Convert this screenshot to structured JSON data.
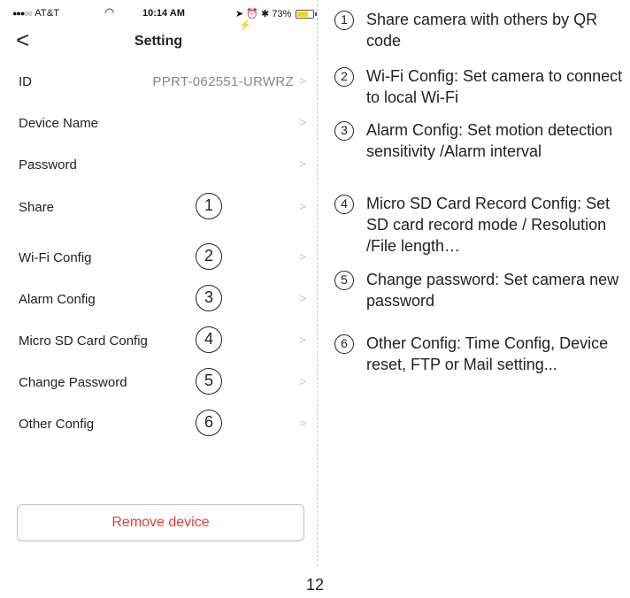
{
  "status_bar": {
    "signal": "●●●○○",
    "carrier": "AT&T",
    "time": "10:14 AM",
    "battery": "73%",
    "battery_level": 0.73
  },
  "nav": {
    "back_label": "<",
    "title": "Setting"
  },
  "rows": [
    {
      "label": "ID",
      "value": "PPRT-062551-URWRZ"
    },
    {
      "label": "Device Name"
    },
    {
      "label": "Password"
    },
    {
      "label": "Share",
      "num": "1"
    },
    {
      "label": "Wi-Fi Config",
      "num": "2"
    },
    {
      "label": "Alarm Config",
      "num": "3"
    },
    {
      "label": "Micro SD Card Config",
      "num": "4"
    },
    {
      "label": "Change Password",
      "num": "5"
    },
    {
      "label": "Other Config",
      "num": "6"
    }
  ],
  "chevron": ">",
  "remove_button": "Remove device",
  "legend": [
    {
      "num": "1",
      "text": "Share camera with others by QR code"
    },
    {
      "num": "2",
      "text": "Wi-Fi Config: Set camera to connect to local Wi-Fi"
    },
    {
      "num": "3",
      "text": "Alarm Config: Set motion detection sensitivity /Alarm interval"
    },
    {
      "num": "4",
      "text": "Micro SD Card Record Config: Set SD card record mode / Resolution /File length…"
    },
    {
      "num": "5",
      "text": "Change password: Set camera new password"
    },
    {
      "num": "6",
      "text": "Other Config: Time Config, Device reset, FTP or Mail setting..."
    }
  ],
  "page_number": "12",
  "colors": {
    "accent_red": "#e53c2f",
    "value_gray": "#888888",
    "battery_yellow": "#f2d600"
  }
}
